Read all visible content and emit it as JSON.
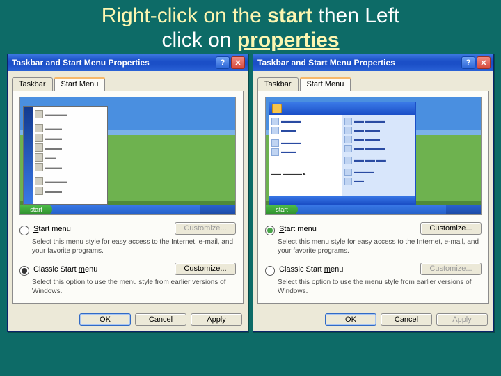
{
  "slide": {
    "line1_a": "Right-click on the ",
    "line1_b": "start",
    "line1_c": " then Left",
    "line2_a": "click on ",
    "line2_b": "properties"
  },
  "left": {
    "title": "Taskbar and Start Menu Properties",
    "tabs": {
      "taskbar": "Taskbar",
      "startmenu": "Start Menu"
    },
    "preview_start": "start",
    "opt_start": {
      "label_pre": "S",
      "label_post": "tart menu",
      "desc": "Select this menu style for easy access to the Internet, e-mail, and your favorite programs.",
      "customize": "Customize...",
      "checked": false
    },
    "opt_classic": {
      "label_pre": "Classic Start ",
      "label_u": "m",
      "label_post": "enu",
      "desc": "Select this option to use the menu style from earlier versions of Windows.",
      "customize": "Customize...",
      "checked": true
    },
    "buttons": {
      "ok": "OK",
      "cancel": "Cancel",
      "apply": "Apply"
    }
  },
  "right": {
    "title": "Taskbar and Start Menu Properties",
    "tabs": {
      "taskbar": "Taskbar",
      "startmenu": "Start Menu"
    },
    "preview_start": "start",
    "opt_start": {
      "label_pre": "S",
      "label_post": "tart menu",
      "desc": "Select this menu style for easy access to the Internet, e-mail, and your favorite programs.",
      "customize": "Customize...",
      "checked": true
    },
    "opt_classic": {
      "label_pre": "Classic Start ",
      "label_u": "m",
      "label_post": "enu",
      "desc": "Select this option to use the menu style from earlier versions of Windows.",
      "customize": "Customize...",
      "checked": false
    },
    "buttons": {
      "ok": "OK",
      "cancel": "Cancel",
      "apply": "Apply"
    }
  }
}
